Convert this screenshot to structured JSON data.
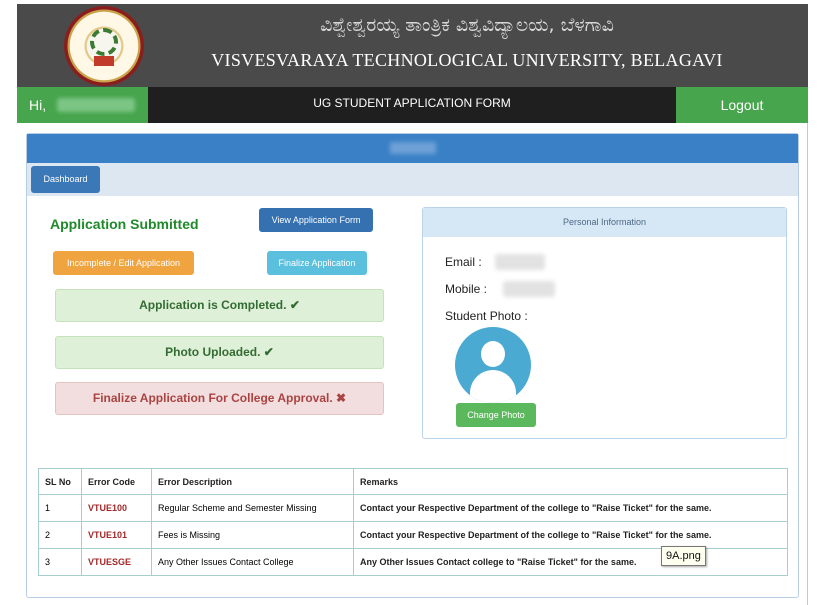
{
  "header": {
    "title_kannada": "ವಿಶ್ವೇಶ್ವರಯ್ಯ ತಾಂತ್ರಿಕ ವಿಶ್ವವಿದ್ಯಾಲಯ, ಬೆಳಗಾವಿ",
    "title_english": "VISVESVARAYA TECHNOLOGICAL UNIVERSITY, BELAGAVI"
  },
  "nav": {
    "greeting": "Hi,",
    "title": "UG STUDENT APPLICATION FORM",
    "logout": "Logout"
  },
  "toolbar": {
    "dashboard": "Dashboard"
  },
  "application": {
    "status": "Application Submitted",
    "view_form": "View Application Form",
    "edit": "Incomplete / Edit Application",
    "finalize": "Finalize Application",
    "alerts": {
      "completed": "Application is Completed.",
      "photo": "Photo Uploaded.",
      "finalize_pending": "Finalize Application For College Approval."
    }
  },
  "personal": {
    "header": "Personal Information",
    "email_label": "Email :",
    "mobile_label": "Mobile :",
    "photo_label": "Student Photo :",
    "change_photo": "Change Photo"
  },
  "errors_table": {
    "headers": [
      "SL No",
      "Error Code",
      "Error Description",
      "Remarks"
    ],
    "rows": [
      [
        "1",
        "VTUE100",
        "Regular Scheme and Semester Missing",
        "Contact your Respective Department of the college to \"Raise Ticket\" for the same."
      ],
      [
        "2",
        "VTUE101",
        "Fees is Missing",
        "Contact your Respective Department of the college to \"Raise Ticket\" for the same."
      ],
      [
        "3",
        "VTUESGE",
        "Any Other Issues Contact College",
        "Any Other Issues Contact college to \"Raise Ticket\" for the same."
      ]
    ]
  },
  "tooltip": "9A.png",
  "icons": {
    "check": "check-icon",
    "cross": "cross-icon"
  },
  "colors": {
    "green": "#47a54d",
    "primary": "#3a80c6",
    "danger": "#a94442"
  }
}
